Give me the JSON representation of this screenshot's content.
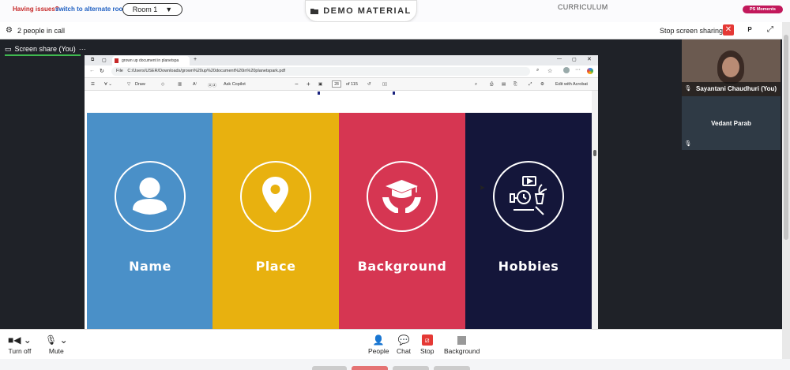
{
  "topbar": {
    "issue_text": "Having issues?",
    "alt_link": "switch to alternate room",
    "room_label": "Room 1",
    "room_caret": "▼",
    "demo_label": "DEMO MATERIAL",
    "demo_icon": "folder-icon",
    "curriculum": "CURRICULUM",
    "moments_label": "PS Moments"
  },
  "call_header": {
    "people_count": "2 people in call",
    "stop_share": "Stop screen sharing",
    "close_glyph": "✕",
    "p_label": "P",
    "expand_glyph": "⤢"
  },
  "stage": {
    "share_tab": "Screen share (You)",
    "share_menu": "···"
  },
  "browser": {
    "tab_title": "grown up document in planetspa",
    "new_tab": "+",
    "url_prefix": "File",
    "url": "C:/Users/USER/Downloads/grown%20up%20document%20in%20planetspark.pdf",
    "toolbar": {
      "draw": "Draw",
      "ask_copilot": "Ask Copilot",
      "minus": "−",
      "plus": "+",
      "page": "28",
      "page_total": "of 115",
      "edit_acrobat": "Edit with Acrobat"
    }
  },
  "slide": {
    "panels": [
      {
        "label": "Name",
        "color": "#4a90c8",
        "icon": "person-icon"
      },
      {
        "label": "Place",
        "color": "#e8b10f",
        "icon": "location-pin-icon"
      },
      {
        "label": "Background",
        "color": "#d63652",
        "icon": "graduation-cap-icon"
      },
      {
        "label": "Hobbies",
        "color": "#14163a",
        "icon": "hobbies-icon"
      }
    ]
  },
  "videos": {
    "self_name": "Sayantani Chaudhuri (You)",
    "other_name": "Vedant Parab"
  },
  "bottombar": {
    "turn_off": "Turn off",
    "mute": "Mute",
    "people": "People",
    "chat": "Chat",
    "stop": "Stop",
    "background": "Background"
  }
}
